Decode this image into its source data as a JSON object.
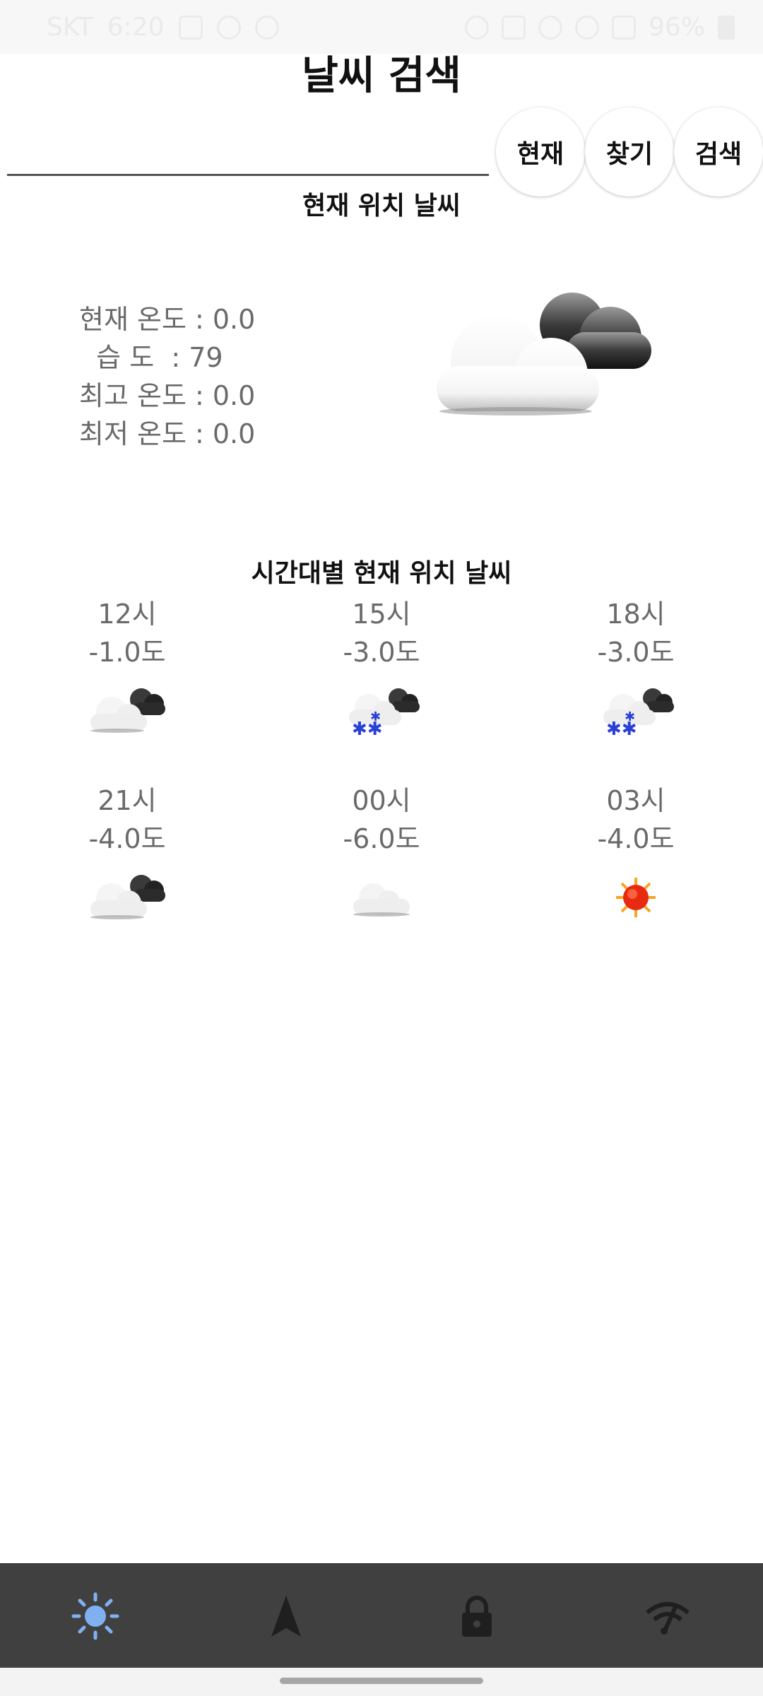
{
  "status_bar": {
    "carrier": "SKT",
    "time": "6:20",
    "battery": "96%"
  },
  "header": {
    "title": "날씨 검색"
  },
  "search": {
    "value": ""
  },
  "buttons": {
    "current": "현재",
    "find": "찾기",
    "search": "검색"
  },
  "current_section": {
    "title": "현재 위치 날씨",
    "temp": "현재 온도 : 0.0",
    "humidity": "  습 도  : 79",
    "max": "최고 온도 : 0.0",
    "min": "최저 온도 : 0.0",
    "icon": "cloudy-icon"
  },
  "hourly_section": {
    "title": "시간대별 현재 위치 날씨",
    "items": [
      {
        "time": "12시",
        "temp": "-1.0도",
        "icon": "cloudy-icon"
      },
      {
        "time": "15시",
        "temp": "-3.0도",
        "icon": "snow-icon"
      },
      {
        "time": "18시",
        "temp": "-3.0도",
        "icon": "snow-icon"
      },
      {
        "time": "21시",
        "temp": "-4.0도",
        "icon": "cloudy-icon"
      },
      {
        "time": "00시",
        "temp": "-6.0도",
        "icon": "cloud-icon"
      },
      {
        "time": "03시",
        "temp": "-4.0도",
        "icon": "sun-icon"
      }
    ]
  },
  "bottom_nav": {
    "items": [
      {
        "icon": "sun-icon",
        "active": true
      },
      {
        "icon": "navigation-arrow-icon",
        "active": false
      },
      {
        "icon": "lock-icon",
        "active": false
      },
      {
        "icon": "network-icon",
        "active": false
      }
    ],
    "active_color": "#7fb0f0",
    "inactive_color": "#222222"
  }
}
